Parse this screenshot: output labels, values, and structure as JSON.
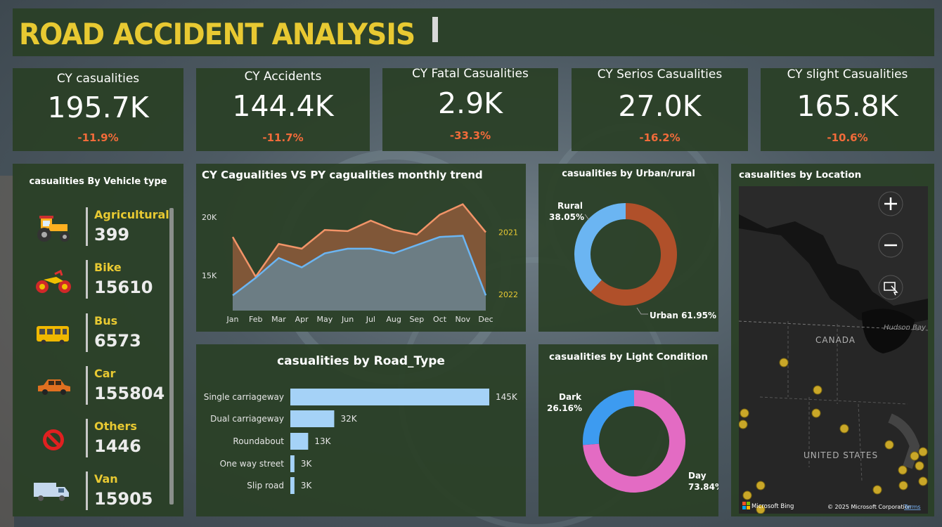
{
  "header": {
    "title": "ROAD ACCIDENT ANALYSIS"
  },
  "kpis": [
    {
      "label": "CY casualities",
      "value": "195.7K",
      "change": "-11.9%"
    },
    {
      "label": "CY Accidents",
      "value": "144.4K",
      "change": "-11.7%"
    },
    {
      "label": "CY Fatal Casualities",
      "value": "2.9K",
      "change": "-33.3%"
    },
    {
      "label": "CY Serios Casualities",
      "value": "27.0K",
      "change": "-16.2%"
    },
    {
      "label": "CY slight Casualities",
      "value": "165.8K",
      "change": "-10.6%"
    }
  ],
  "vehicle": {
    "title": "casualities By Vehicle type",
    "items": [
      {
        "name": "Agricultural",
        "value": "399",
        "icon": "tractor-icon"
      },
      {
        "name": "Bike",
        "value": "15610",
        "icon": "motorbike-icon"
      },
      {
        "name": "Bus",
        "value": "6573",
        "icon": "bus-icon"
      },
      {
        "name": "Car",
        "value": "155804",
        "icon": "car-icon"
      },
      {
        "name": "Others",
        "value": "1446",
        "icon": "no-entry-icon"
      },
      {
        "name": "Van",
        "value": "15905",
        "icon": "van-icon"
      }
    ]
  },
  "map": {
    "title": "casualities by Location",
    "labels": {
      "hudson": "Hudson Bay",
      "canada": "CANADA",
      "us": "UNITED STATES"
    },
    "attribution": {
      "bing": "Microsoft Bing",
      "copyright": "© 2025 Microsoft Corporation",
      "terms": "Terms"
    }
  },
  "colors": {
    "panel": "#2a4026",
    "accent_yellow": "#e8c932",
    "negative": "#f26b3a",
    "cy_line": "#f29468",
    "py_line": "#6bb5f2",
    "rural": "#6bb5f2",
    "urban": "#b0502a",
    "dark": "#3d9bf0",
    "day": "#e36bc3",
    "bar": "#a5d2f7"
  },
  "chart_data": [
    {
      "type": "area",
      "title": "CY Cagualities VS PY cagualities monthly trend",
      "categories": [
        "Jan",
        "Feb",
        "Mar",
        "Apr",
        "May",
        "Jun",
        "Jul",
        "Aug",
        "Sep",
        "Oct",
        "Nov",
        "Dec"
      ],
      "yticks": [
        15000,
        20000
      ],
      "ytick_labels": [
        "15K",
        "20K"
      ],
      "ylim": [
        12000,
        21800
      ],
      "series": [
        {
          "name": "2021",
          "values": [
            18300,
            14900,
            17700,
            17300,
            18900,
            18800,
            19700,
            18900,
            18500,
            20200,
            21100,
            18700
          ]
        },
        {
          "name": "2022",
          "values": [
            13300,
            14800,
            16500,
            15700,
            16900,
            17300,
            17300,
            16900,
            17600,
            18300,
            18400,
            13300
          ]
        }
      ]
    },
    {
      "type": "pie",
      "title": "casualities by Urban/rural",
      "labels": [
        "Rural",
        "Urban"
      ],
      "values": [
        38.05,
        61.95
      ],
      "value_labels": [
        "38.05%",
        "61.95%"
      ]
    },
    {
      "type": "bar",
      "title": "casualities by Road_Type",
      "categories": [
        "Single carriageway",
        "Dual carriageway",
        "Roundabout",
        "One way street",
        "Slip road"
      ],
      "values": [
        145000,
        32000,
        13000,
        3000,
        3000
      ],
      "value_labels": [
        "145K",
        "32K",
        "13K",
        "3K",
        "3K"
      ]
    },
    {
      "type": "pie",
      "title": "casualities by Light Condition",
      "labels": [
        "Dark",
        "Day"
      ],
      "values": [
        26.16,
        73.84
      ],
      "value_labels": [
        "26.16%",
        "73.84%"
      ]
    }
  ]
}
